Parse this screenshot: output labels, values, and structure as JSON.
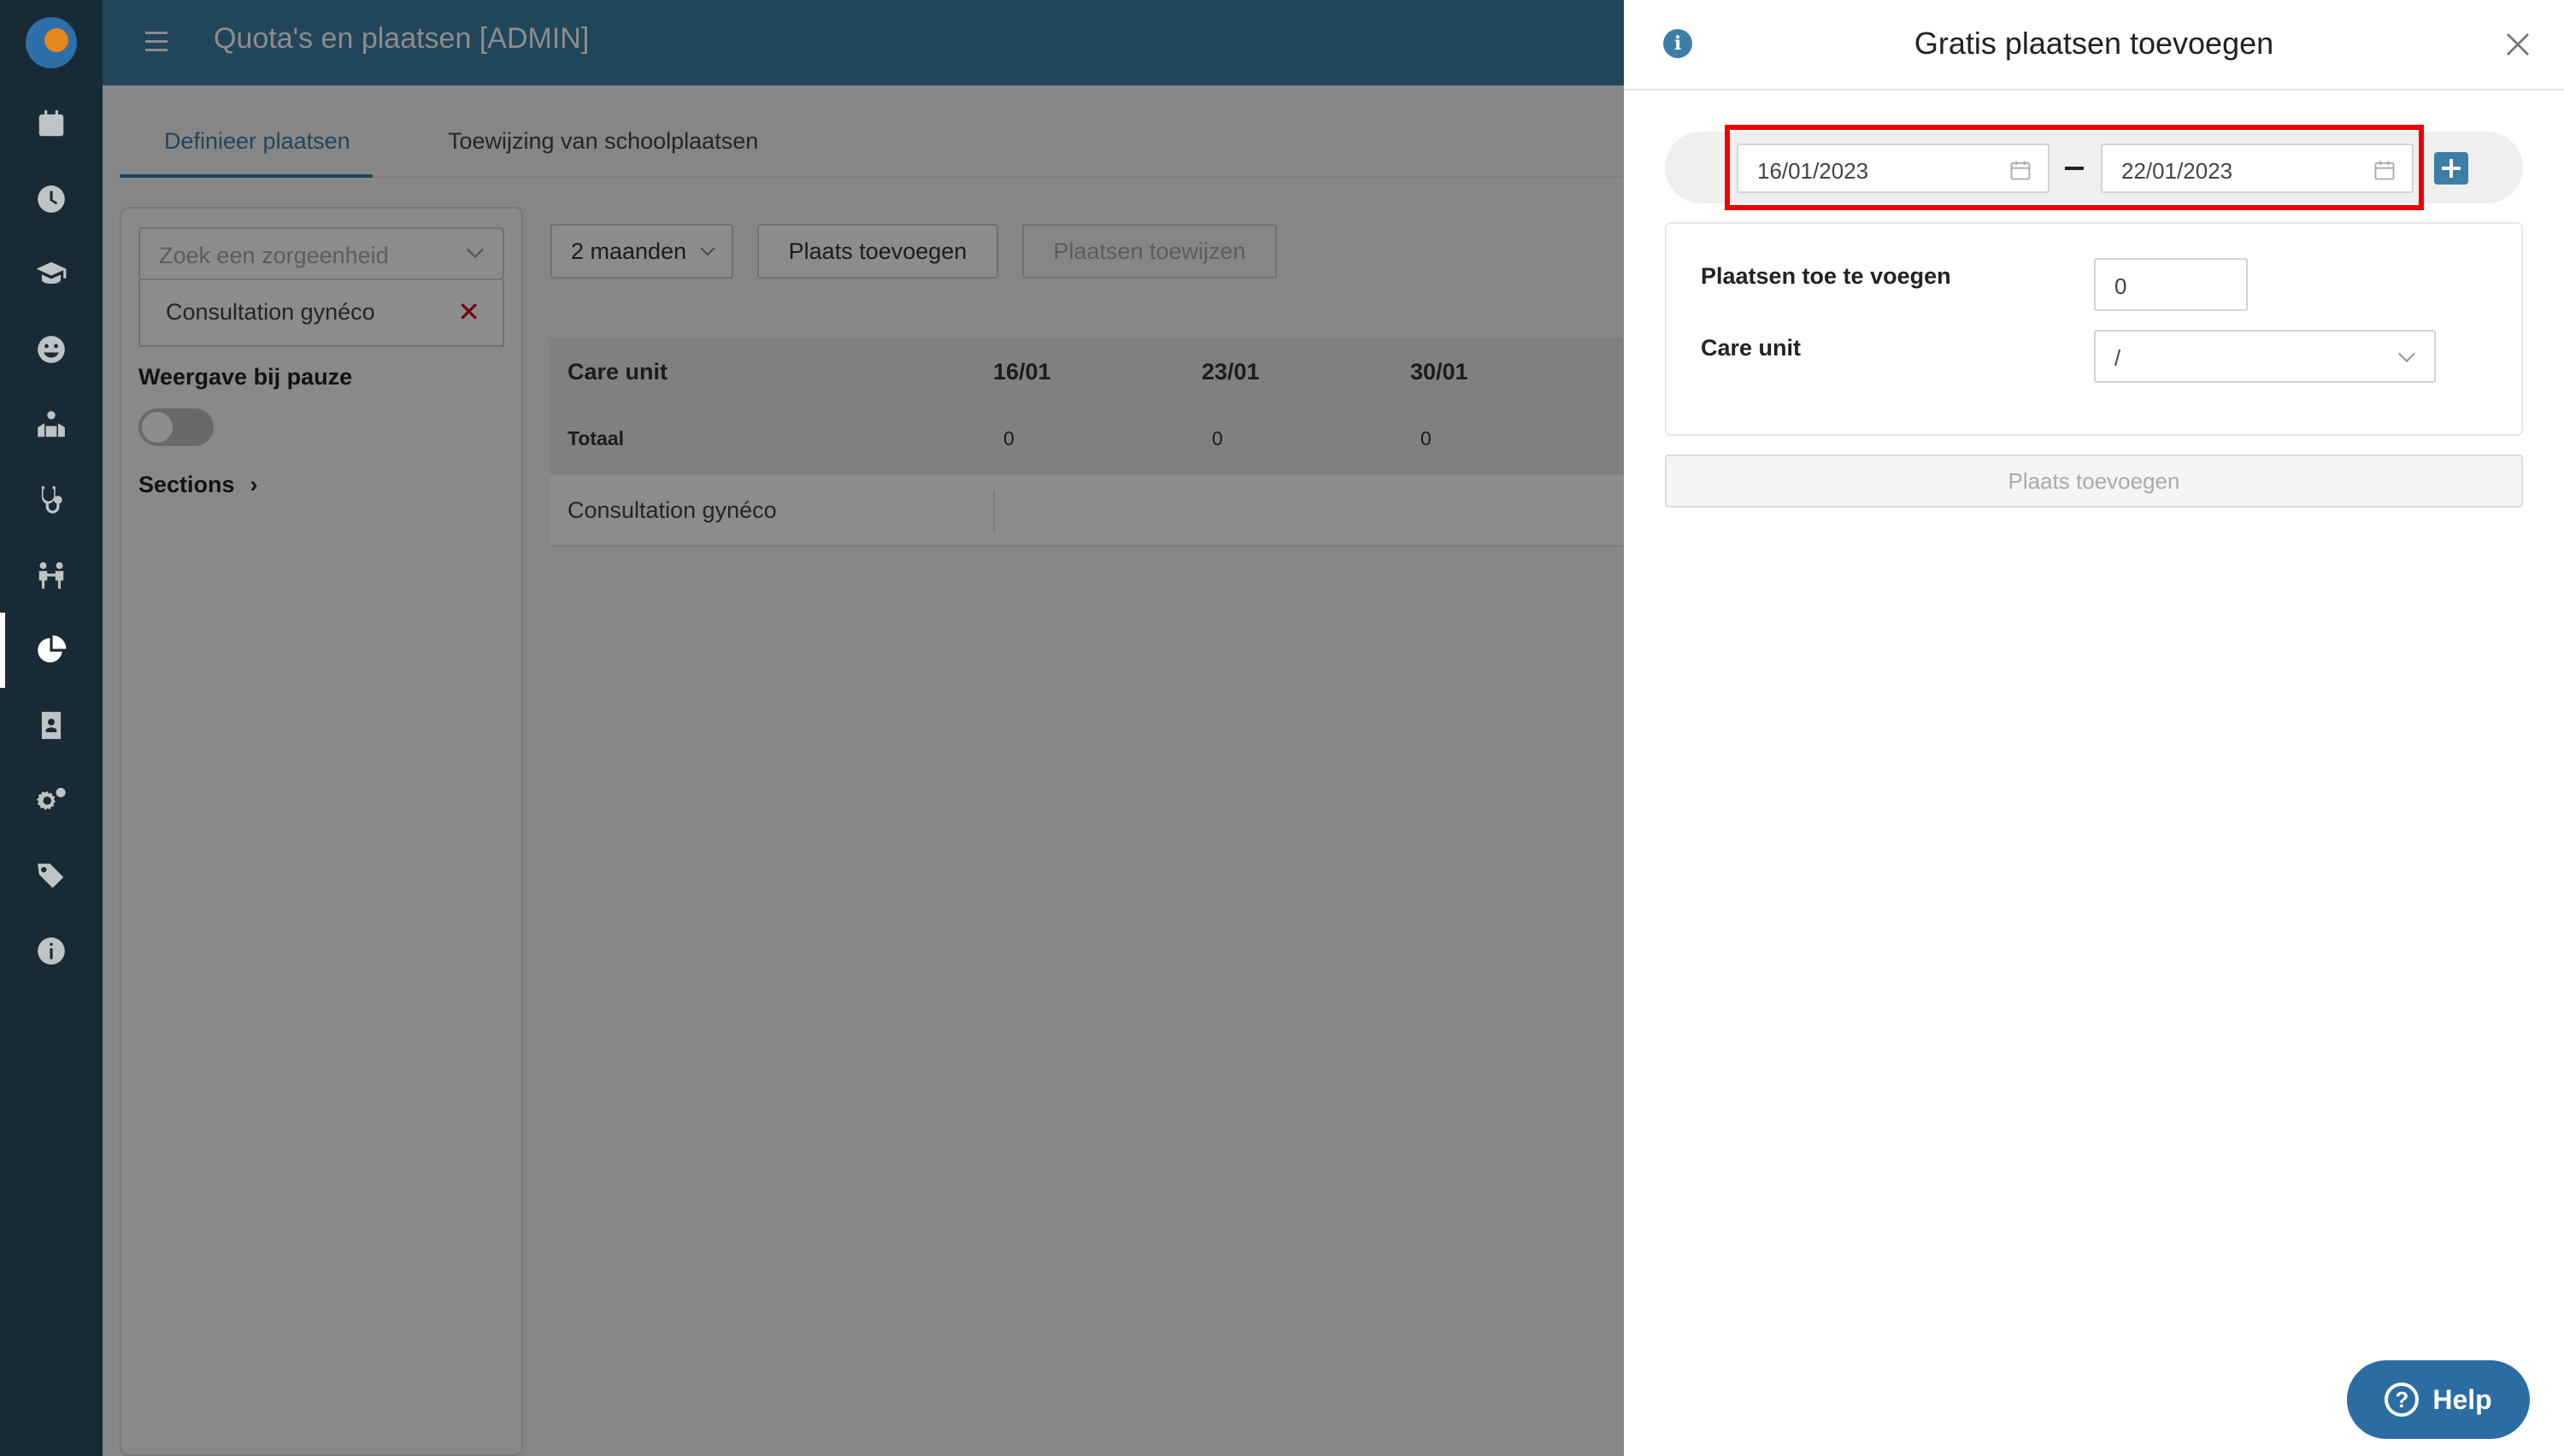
{
  "app": {
    "title": "Quota's en plaatsen [ADMIN]"
  },
  "rail": {
    "icons": [
      "calendar-icon",
      "clock-icon",
      "graduation-cap-icon",
      "smiley-icon",
      "classroom-icon",
      "stethoscope-icon",
      "people-icon",
      "pie-chart-icon",
      "id-card-icon",
      "gears-icon",
      "tags-icon",
      "info-icon"
    ],
    "active": "pie-chart-icon"
  },
  "tabs": [
    {
      "label": "Definieer plaatsen",
      "active": true
    },
    {
      "label": "Toewijzing van schoolplaatsen",
      "active": false
    }
  ],
  "filters": {
    "search_placeholder": "Zoek een zorgeenheid",
    "selected_unit": "Consultation gynéco",
    "pause_label": "Weergave bij pauze",
    "pause_enabled": false,
    "sections_label": "Sections"
  },
  "toolbar": {
    "period": "2 maanden",
    "add_place": "Plaats toevoegen",
    "assign_places": "Plaatsen toewijzen"
  },
  "grid": {
    "header": "Care unit",
    "weeks": [
      "16/01",
      "23/01",
      "30/01"
    ],
    "total_label": "Totaal",
    "totals": [
      "0",
      "0",
      "0"
    ],
    "rows": [
      {
        "name": "Consultation gynéco"
      }
    ]
  },
  "drawer": {
    "title": "Gratis plaatsen toevoegen",
    "date_from": "16/01/2023",
    "date_to": "22/01/2023",
    "places_label": "Plaatsen toe te voegen",
    "places_value": "0",
    "care_unit_label": "Care unit",
    "care_unit_value": "/",
    "submit": "Plaats toevoegen"
  },
  "help": {
    "label": "Help"
  },
  "colors": {
    "brand": "#3d7ea7",
    "rail": "#182a35",
    "highlight": "#e00000",
    "danger": "#d0021b"
  }
}
